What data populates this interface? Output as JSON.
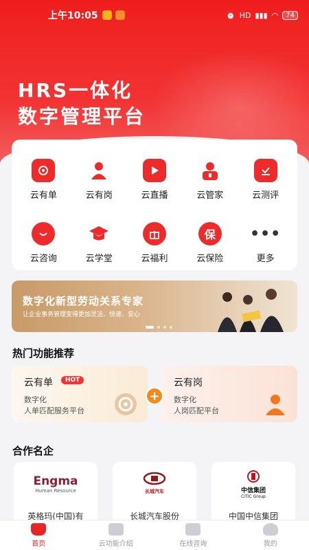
{
  "status_bar": {
    "time": "上午10:05",
    "battery": "74",
    "network": "HD"
  },
  "hero": {
    "line1": "HRS一体化",
    "line2": "数字管理平台"
  },
  "grid": [
    {
      "label": "云有单",
      "icon": "order-icon"
    },
    {
      "label": "云有岗",
      "icon": "person-icon"
    },
    {
      "label": "云直播",
      "icon": "play-icon"
    },
    {
      "label": "云管家",
      "icon": "steward-icon"
    },
    {
      "label": "云测评",
      "icon": "evaluation-icon"
    },
    {
      "label": "云咨询",
      "icon": "chat-icon"
    },
    {
      "label": "云学堂",
      "icon": "graduation-cap-icon"
    },
    {
      "label": "云福利",
      "icon": "gift-icon"
    },
    {
      "label": "云保险",
      "icon": "insurance-icon",
      "glyph": "保"
    },
    {
      "label": "更多",
      "icon": "more-icon",
      "glyph": "•••"
    }
  ],
  "banner": {
    "title": "数字化新型劳动关系专家",
    "subtitle": "让企业事务管理变得更加灵活、快速、安心"
  },
  "hot_section": {
    "title": "热门功能推荐",
    "cards": [
      {
        "name": "云有单",
        "badge": "HOT",
        "desc1": "数字化",
        "desc2": "人单匹配服务平台"
      },
      {
        "name": "云有岗",
        "desc1": "数字化",
        "desc2": "人岗匹配平台"
      }
    ]
  },
  "partners_section": {
    "title": "合作名企",
    "items": [
      {
        "name": "英格玛(中国)有",
        "logo_text": "Engma",
        "logo_sub": "Human Resource"
      },
      {
        "name": "长城汽车股份",
        "logo_text": "长城汽车"
      },
      {
        "name": "中国中信集团",
        "logo_text": "中信集团",
        "logo_sub": "CITIC Group"
      }
    ]
  },
  "tabbar": [
    {
      "label": "首页",
      "active": true
    },
    {
      "label": "云功能介绍"
    },
    {
      "label": "在线咨询"
    },
    {
      "label": "我的"
    }
  ],
  "colors": {
    "brand_red": "#ee2b2b",
    "banner_gold": "#c89a67",
    "plus_orange": "#f28a1b"
  }
}
